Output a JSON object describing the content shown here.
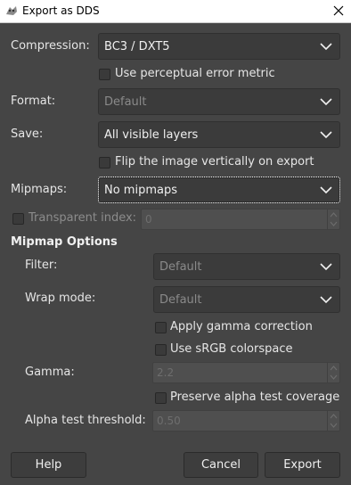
{
  "window": {
    "title": "Export as DDS"
  },
  "compression": {
    "label": "Compression:",
    "value": "BC3 / DXT5"
  },
  "perceptual": {
    "label": "Use perceptual error metric"
  },
  "format": {
    "label": "Format:",
    "value": "Default"
  },
  "save": {
    "label": "Save:",
    "value": "All visible layers"
  },
  "flip": {
    "label": "Flip the image vertically on export"
  },
  "mipmaps": {
    "label": "Mipmaps:",
    "value": "No mipmaps"
  },
  "transparent": {
    "label": "Transparent index:",
    "value": "0"
  },
  "mipmap_options": {
    "heading": "Mipmap Options",
    "filter": {
      "label": "Filter:",
      "value": "Default"
    },
    "wrap": {
      "label": "Wrap mode:",
      "value": "Default"
    },
    "gamma_correction": {
      "label": "Apply gamma correction"
    },
    "srgb": {
      "label": "Use sRGB colorspace"
    },
    "gamma": {
      "label": "Gamma:",
      "value": "2.2"
    },
    "preserve_alpha": {
      "label": "Preserve alpha test coverage"
    },
    "alpha_threshold": {
      "label": "Alpha test threshold:",
      "value": "0.50"
    }
  },
  "buttons": {
    "help": "Help",
    "cancel": "Cancel",
    "export": "Export"
  },
  "icons": {
    "app": "gimp-icon",
    "close": "close-icon",
    "dropdown": "chevron-down-icon"
  },
  "colors": {
    "background": "#454545",
    "text": "#e6e6e6",
    "disabled_text": "#8c8c8c",
    "titlebar": "#ffffff"
  }
}
